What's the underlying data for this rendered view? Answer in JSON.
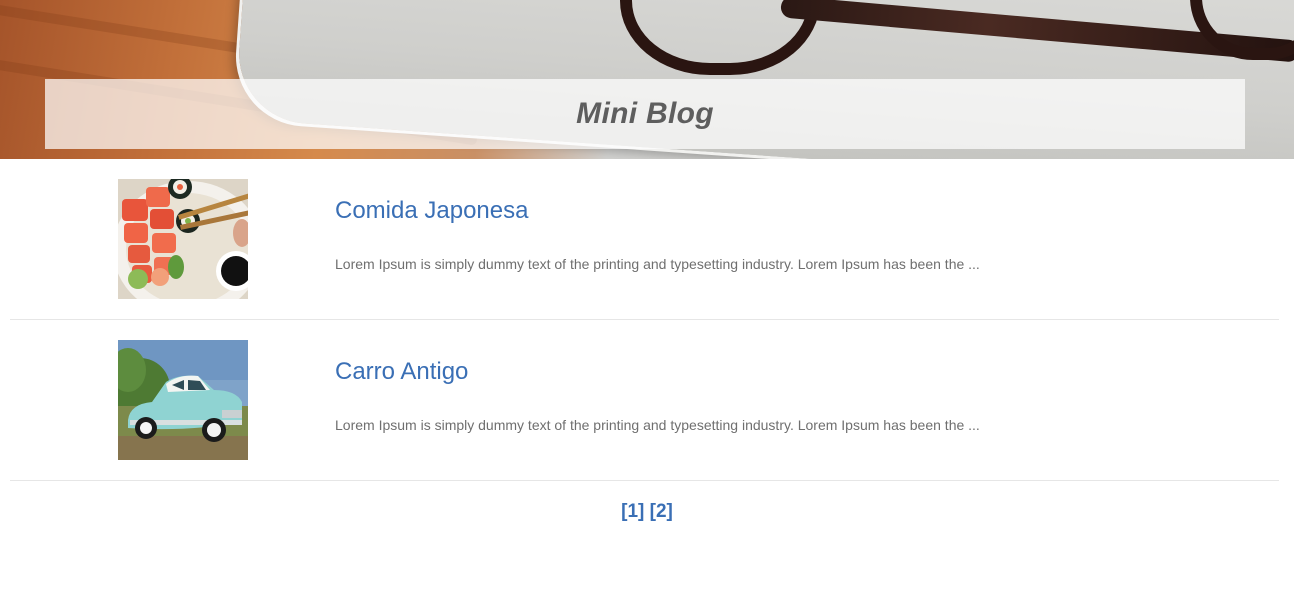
{
  "header": {
    "title": "Mini Blog"
  },
  "posts": [
    {
      "title": "Comida Japonesa",
      "excerpt": "Lorem Ipsum is simply dummy text of the printing and typesetting industry. Lorem Ipsum has been the ...",
      "image": "sushi-photo"
    },
    {
      "title": "Carro Antigo",
      "excerpt": "Lorem Ipsum is simply dummy text of the printing and typesetting industry. Lorem Ipsum has been the ...",
      "image": "vintage-car-photo"
    }
  ],
  "pagination": {
    "pages": [
      "[1]",
      "[2]"
    ]
  },
  "colors": {
    "link": "#3a6fb5",
    "title": "#5e5e5e",
    "excerpt": "#6f6f6f",
    "divider": "#e6e6e6"
  }
}
